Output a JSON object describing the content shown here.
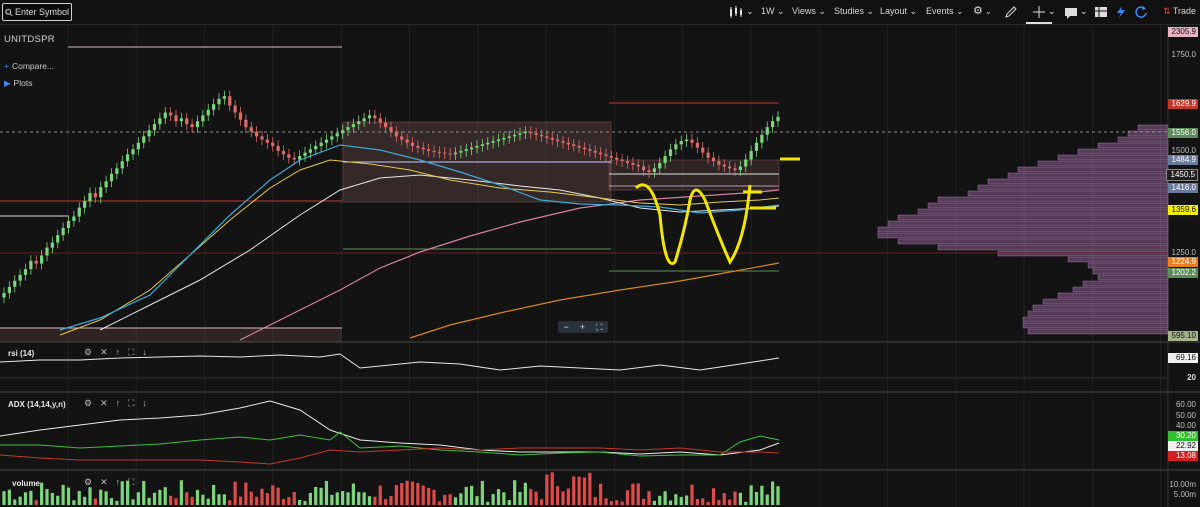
{
  "toolbar": {
    "search_placeholder": "Enter Symbol",
    "interval": "1W",
    "views": "Views",
    "studies": "Studies",
    "layout": "Layout",
    "events": "Events",
    "trade": "Trade"
  },
  "symbol": "UNITDSPR",
  "side": {
    "compare": "Compare...",
    "plots": "Plots"
  },
  "panes": {
    "rsi": {
      "label": "rsi (14)",
      "value": "69.16",
      "level": "20"
    },
    "adx": {
      "label": "ADX (14,14,y,n)",
      "ticks": [
        "60.00",
        "50.00",
        "40.00"
      ],
      "values": [
        "30.20",
        "22.92",
        "13.08"
      ]
    },
    "volume": {
      "label": "volume",
      "ticks": [
        "10.00m",
        "5.00m"
      ]
    }
  },
  "price_tags": [
    {
      "label": "2305.9",
      "color": "#e8b4c4"
    },
    {
      "label": "1629.9",
      "color": "#c0392b"
    },
    {
      "label": "1556.0",
      "color": "#5b8c5a"
    },
    {
      "label": "1484.9",
      "color": "#6a7a9a"
    },
    {
      "label": "1450.5",
      "color": "#202020"
    },
    {
      "label": "1416.0",
      "color": "#6a7a9a"
    },
    {
      "label": "1359.6",
      "color": "#f2f200"
    },
    {
      "label": "1224.9",
      "color": "#e67e22"
    },
    {
      "label": "1202.2",
      "color": "#5b8c5a"
    },
    {
      "label": "595.10",
      "color": "#a5b48a"
    }
  ],
  "price_axis_ticks": [
    "1750.0",
    "1500.0",
    "1250.0"
  ],
  "icons": [
    "search-icon",
    "candles-icon",
    "gear-icon",
    "pencil-icon",
    "crosshair-icon",
    "comment-icon",
    "table-icon",
    "lightning-icon",
    "refresh-icon"
  ],
  "chart_data": {
    "type": "candlestick",
    "y_scale": "log",
    "ylim": [
      595.1,
      2305.9
    ],
    "levels": [
      1750,
      1629.9,
      1556.0,
      1500,
      1484.9,
      1450.5,
      1416.0,
      1359.6,
      1250,
      1224.9,
      1202.2
    ],
    "closes": [
      720,
      740,
      760,
      780,
      800,
      830,
      820,
      850,
      880,
      900,
      930,
      960,
      990,
      1010,
      1050,
      1080,
      1120,
      1100,
      1150,
      1180,
      1220,
      1250,
      1290,
      1330,
      1360,
      1400,
      1440,
      1480,
      1520,
      1560,
      1600,
      1580,
      1540,
      1560,
      1520,
      1500,
      1540,
      1580,
      1620,
      1660,
      1700,
      1720,
      1650,
      1600,
      1550,
      1500,
      1470,
      1440,
      1420,
      1400,
      1380,
      1350,
      1330,
      1310,
      1300,
      1320,
      1340,
      1360,
      1380,
      1400,
      1420,
      1440,
      1460,
      1480,
      1500,
      1520,
      1540,
      1560,
      1580,
      1560,
      1530,
      1500,
      1470,
      1440,
      1420,
      1400,
      1380,
      1370,
      1360,
      1350,
      1345,
      1340,
      1335,
      1330,
      1340,
      1350,
      1360,
      1370,
      1380,
      1390,
      1400,
      1410,
      1420,
      1430,
      1440,
      1450,
      1460,
      1470,
      1460,
      1450,
      1440,
      1430,
      1420,
      1410,
      1400,
      1390,
      1380,
      1370,
      1360,
      1350,
      1340,
      1330,
      1320,
      1310,
      1300,
      1290,
      1280,
      1270,
      1260,
      1240,
      1230,
      1250,
      1280,
      1320,
      1360,
      1390,
      1410,
      1420,
      1400,
      1370,
      1340,
      1310,
      1290,
      1270,
      1260,
      1250,
      1240,
      1260,
      1300,
      1350,
      1400,
      1450,
      1500,
      1540,
      1570
    ]
  }
}
